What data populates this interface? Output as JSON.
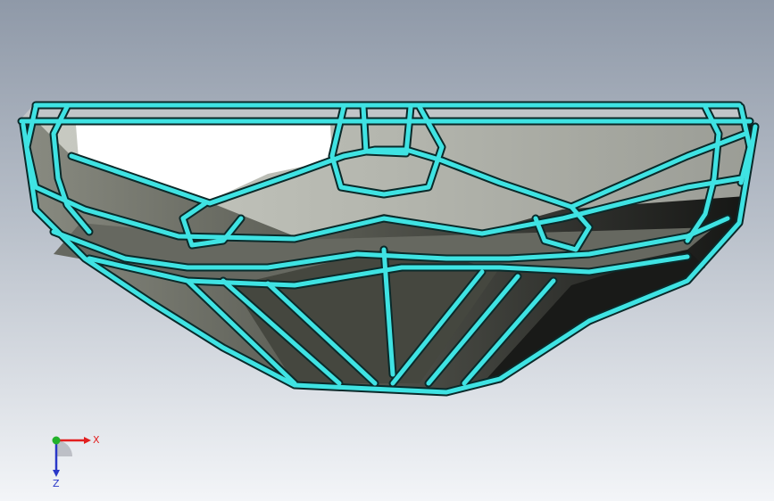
{
  "viewport": {
    "background_top": "#8f99a8",
    "background_bottom": "#f3f5f8"
  },
  "model": {
    "part": "faceted-bowl",
    "edge_highlight_color": "#3fe3e3",
    "edge_outline_color": "#0a2a2a",
    "face_colors": {
      "rim": "#bfc3c7",
      "inner_light": "#ffffff",
      "inner_mid": "#c7c9c2",
      "inner_shade": "#9ea19a",
      "outer_light": "#7c7e73",
      "outer_mid": "#4f5149",
      "outer_dark": "#1c1d1b"
    }
  },
  "triad": {
    "x_label": "X",
    "z_label": "Z",
    "x_color": "#e21f1f",
    "y_color": "#21b12a",
    "z_color": "#2a38c8"
  }
}
